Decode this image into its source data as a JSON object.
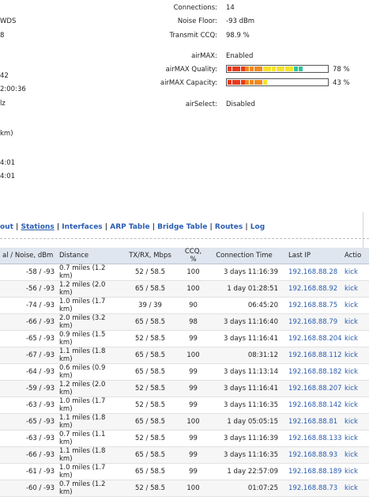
{
  "left_fragments": [
    "WDS",
    "8",
    "42",
    "2:00:36",
    "lz",
    "km)",
    "4:01",
    "4:01"
  ],
  "status": {
    "connections_label": "Connections:",
    "connections_value": "14",
    "noise_label": "Noise Floor:",
    "noise_value": "-93 dBm",
    "ccq_label": "Transmit CCQ:",
    "ccq_value": "98.9 %",
    "airmax_label": "airMAX:",
    "airmax_value": "Enabled",
    "quality_label": "airMAX Quality:",
    "quality_value": "78 %",
    "quality_fraction": 0.78,
    "capacity_label": "airMAX Capacity:",
    "capacity_value": "43 %",
    "capacity_fraction": 0.43,
    "airselect_label": "airSelect:",
    "airselect_value": "Disabled"
  },
  "colors": {
    "bar_low": "#e83a1a",
    "bar_mid": "#f7e22a",
    "bar_high": "#2fc49a",
    "link": "#2a5db0",
    "header_bg": "#dfe6ef"
  },
  "nav": {
    "items": [
      "out",
      "Stations",
      "Interfaces",
      "ARP Table",
      "Bridge Table",
      "Routes",
      "Log"
    ],
    "active": "Stations"
  },
  "table": {
    "headers": [
      "al / Noise, dBm",
      "Distance",
      "TX/RX, Mbps",
      "CCQ, %",
      "Connection Time",
      "Last IP",
      "Actio"
    ],
    "rows": [
      [
        "-58 / -93",
        "0.7 miles (1.2 km)",
        "52 / 58.5",
        "100",
        "3 days 11:16:39",
        "192.168.88.28",
        "kick"
      ],
      [
        "-56 / -93",
        "1.2 miles (2.0 km)",
        "65 / 58.5",
        "100",
        "1 day 01:28:51",
        "192.168.88.92",
        "kick"
      ],
      [
        "-74 / -93",
        "1.0 miles (1.7 km)",
        "39 / 39",
        "90",
        "06:45:20",
        "192.168.88.75",
        "kick"
      ],
      [
        "-66 / -93",
        "2.0 miles (3.2 km)",
        "65 / 58.5",
        "98",
        "3 days 11:16:40",
        "192.168.88.79",
        "kick"
      ],
      [
        "-65 / -93",
        "0.9 miles (1.5 km)",
        "52 / 58.5",
        "99",
        "3 days 11:16:41",
        "192.168.88.204",
        "kick"
      ],
      [
        "-67 / -93",
        "1.1 miles (1.8 km)",
        "65 / 58.5",
        "100",
        "08:31:12",
        "192.168.88.112",
        "kick"
      ],
      [
        "-64 / -93",
        "0.6 miles (0.9 km)",
        "65 / 58.5",
        "99",
        "3 days 11:13:14",
        "192.168.88.182",
        "kick"
      ],
      [
        "-59 / -93",
        "1.2 miles (2.0 km)",
        "52 / 58.5",
        "99",
        "3 days 11:16:41",
        "192.168.88.207",
        "kick"
      ],
      [
        "-63 / -93",
        "1.0 miles (1.7 km)",
        "52 / 58.5",
        "99",
        "3 days 11:16:35",
        "192.168.88.142",
        "kick"
      ],
      [
        "-65 / -93",
        "1.1 miles (1.8 km)",
        "65 / 58.5",
        "100",
        "1 day 05:05:15",
        "192.168.88.81",
        "kick"
      ],
      [
        "-63 / -93",
        "0.7 miles (1.1 km)",
        "52 / 58.5",
        "99",
        "3 days 11:16:39",
        "192.168.88.133",
        "kick"
      ],
      [
        "-66 / -93",
        "1.1 miles (1.8 km)",
        "65 / 58.5",
        "99",
        "3 days 11:16:35",
        "192.168.88.93",
        "kick"
      ],
      [
        "-61 / -93",
        "1.0 miles (1.7 km)",
        "65 / 58.5",
        "99",
        "1 day 22:57:09",
        "192.168.88.189",
        "kick"
      ],
      [
        "-60 / -93",
        "0.7 miles (1.2 km)",
        "52 / 58.5",
        "100",
        "01:07:25",
        "192.168.88.73",
        "kick"
      ]
    ]
  }
}
